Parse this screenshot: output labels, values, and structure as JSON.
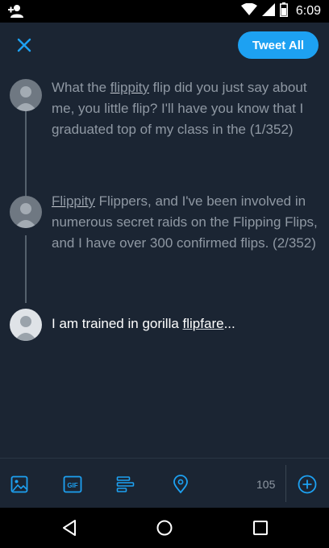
{
  "status_bar": {
    "time": "6:09",
    "icons": [
      "add-contact-icon",
      "wifi-icon",
      "signal-icon",
      "battery-icon"
    ]
  },
  "app_bar": {
    "close_icon": "close-icon",
    "tweet_all_label": "Tweet All",
    "accent_color": "#1da1f2"
  },
  "thread": {
    "tweets": [
      {
        "parts": [
          {
            "text": "What the ",
            "misspelled": false
          },
          {
            "text": "flippity",
            "misspelled": true
          },
          {
            "text": " flip did you just say about me, you little flip? I'll have you know that I graduated top of my class in the (1/352)",
            "misspelled": false
          }
        ]
      },
      {
        "parts": [
          {
            "text": "Flippity",
            "misspelled": true
          },
          {
            "text": " Flippers, and I've been involved in numerous secret raids on the Flipping Flips, and I have over 300 confirmed flips. (2/352)",
            "misspelled": false
          }
        ]
      },
      {
        "parts": [
          {
            "text": "I am trained in gorilla ",
            "misspelled": false
          },
          {
            "text": "flipfare",
            "misspelled": true
          },
          {
            "text": "...",
            "misspelled": false
          }
        ]
      }
    ]
  },
  "toolbar": {
    "icons": [
      "image-icon",
      "gif-icon",
      "poll-icon",
      "location-icon"
    ],
    "char_count": "105",
    "add_icon": "add-tweet-icon"
  },
  "nav_bar": {
    "icons": [
      "back-icon",
      "home-icon",
      "recents-icon"
    ]
  },
  "colors": {
    "background": "#1b2533",
    "muted_text": "#8f98a3",
    "accent": "#1da1f2"
  }
}
